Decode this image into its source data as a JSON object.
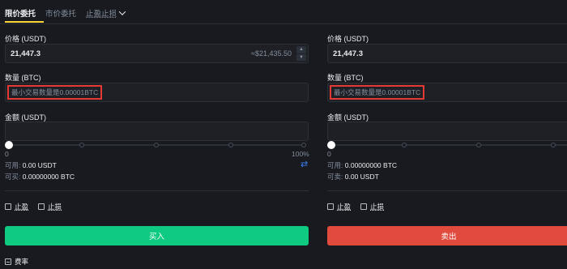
{
  "tabs": {
    "limit": "限价委托",
    "market": "市价委托",
    "stop": "止盈止损"
  },
  "buy": {
    "price_label": "价格 (USDT)",
    "price_value": "21,447.3",
    "price_approx": "≈$21,435.50",
    "amount_label": "数量 (BTC)",
    "amount_placeholder": "最小交易数量是0.00001BTC",
    "total_label": "金额 (USDT)",
    "slider_min": "0",
    "slider_max": "100%",
    "slider_value_percent": 0,
    "available_label": "可用:",
    "available_value": "0.00 USDT",
    "canbuy_label": "可买:",
    "canbuy_value": "0.00000000 BTC",
    "take_profit": "止盈",
    "stop_loss": "止损",
    "button": "买入"
  },
  "sell": {
    "price_label": "价格 (USDT)",
    "price_value": "21,447.3",
    "amount_label": "数量 (BTC)",
    "amount_placeholder": "最小交易数量是0.00001BTC",
    "total_label": "金额 (USDT)",
    "slider_min": "0",
    "slider_value_percent": 0,
    "available_label": "可用:",
    "available_value": "0.00000000 BTC",
    "cansell_label": "可卖:",
    "cansell_value": "0.00 USDT",
    "take_profit": "止盈",
    "stop_loss": "止损",
    "button": "卖出"
  },
  "fee_label": "费率",
  "colors": {
    "background": "#181a20",
    "buy": "#0ecb81",
    "sell": "#e04b3e",
    "highlight_box": "#e53935",
    "accent": "#fcd535"
  },
  "icons": {
    "dropdown": "chevron-down-icon",
    "swap": "swap-arrows-icon",
    "fee": "fee-icon"
  }
}
